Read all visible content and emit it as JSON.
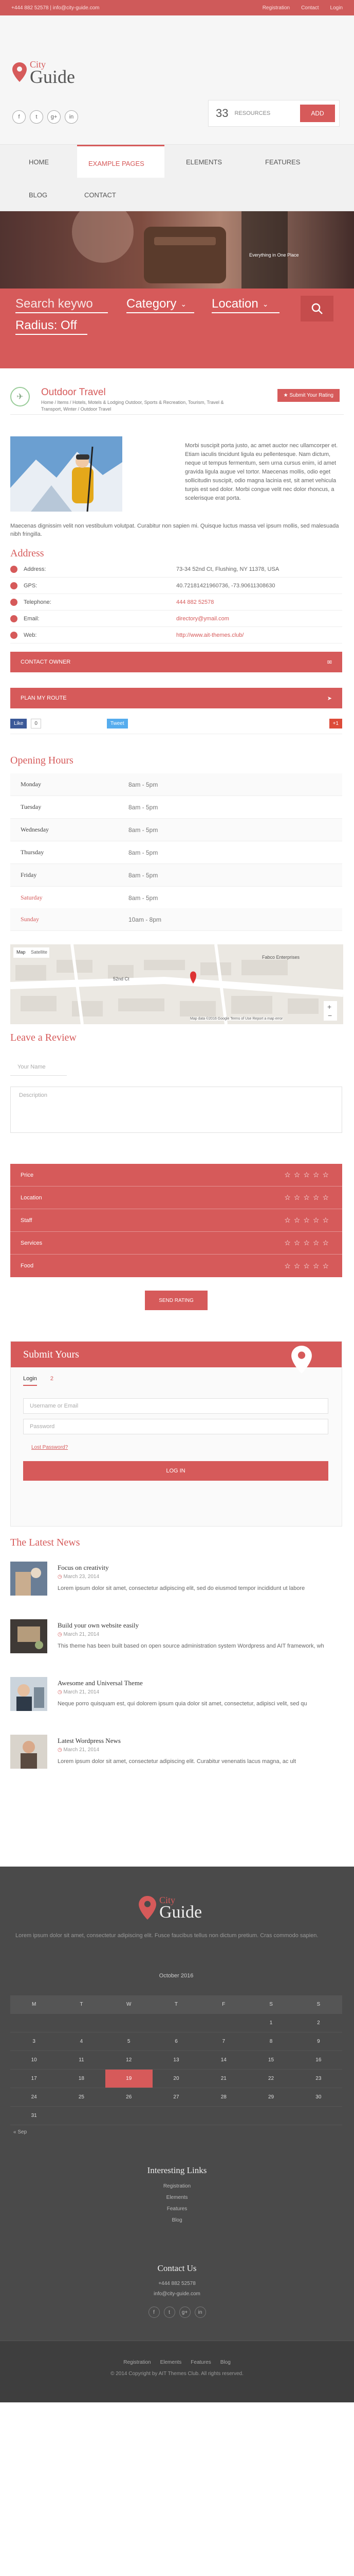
{
  "topbar": {
    "contact": "+444 882 52578 | info@city-guide.com",
    "links": [
      "Registration",
      "Contact",
      "Login"
    ]
  },
  "brand": {
    "line1": "City",
    "line2": "Guide",
    "accent": "#d65a5a"
  },
  "social": [
    "f",
    "t",
    "g+",
    "in"
  ],
  "resources": {
    "count": "33",
    "label": "RESOURCES",
    "add_label": "ADD"
  },
  "nav": {
    "items": [
      "HOME",
      "EXAMPLE PAGES",
      "ELEMENTS",
      "FEATURES",
      "BLOG",
      "CONTACT"
    ],
    "active": "EXAMPLE PAGES"
  },
  "hero": {
    "tag": "Everything in One Place"
  },
  "search": {
    "keyword_placeholder": "Search keywo",
    "category_label": "Category",
    "location_label": "Location",
    "radius_label": "Radius: Off"
  },
  "listing": {
    "title": "Outdoor Travel",
    "breadcrumb": "Home  /  Items  /  Hotels, Motels & Lodging Outdoor, Sports & Recreation, Tourism, Travel & Transport, Winter  /  Outdoor Travel",
    "submit_rating": "Submit Your Rating",
    "description": "Morbi suscipit porta justo, ac amet auctor nec ullamcorper et. Etiam iaculis tincidunt ligula eu pellentesque. Nam dictum, neque ut tempus fermentum, sem urna cursus enim, id amet gravida ligula augue vel tortor. Maecenas mollis, odio eget sollicitudin suscipit, odio magna lacinia est, sit amet vehicula turpis est sed dolor. Morbi congue velit nec dolor rhoncus, a scelerisque erat porta.",
    "description2": "Maecenas dignissim velit non vestibulum volutpat. Curabitur non sapien mi. Quisque luctus massa vel ipsum mollis, sed malesuada nibh fringilla."
  },
  "address": {
    "heading": "Address",
    "rows": [
      {
        "key": "Address:",
        "value": "73-34 52nd Ct, Flushing, NY 11378, USA"
      },
      {
        "key": "GPS:",
        "value": "40.72181421960736, -73.90611308630"
      },
      {
        "key": "Telephone:",
        "value": "444 882 52578"
      },
      {
        "key": "Email:",
        "value": "directory@ymail.com"
      },
      {
        "key": "Web:",
        "value": "http://www.ait-themes.club/"
      }
    ],
    "contact_owner": "CONTACT OWNER",
    "plan_route": "PLAN MY ROUTE",
    "share": [
      "Like",
      "0",
      "Tweet",
      "+1"
    ]
  },
  "hours": {
    "heading": "Opening Hours",
    "rows": [
      {
        "day": "Monday",
        "time": "8am - 5pm"
      },
      {
        "day": "Tuesday",
        "time": "8am - 5pm"
      },
      {
        "day": "Wednesday",
        "time": "8am - 5pm"
      },
      {
        "day": "Thursday",
        "time": "8am - 5pm"
      },
      {
        "day": "Friday",
        "time": "8am - 5pm"
      },
      {
        "day": "Saturday",
        "time": "8am - 5pm"
      },
      {
        "day": "Sunday",
        "time": "10am - 8pm"
      }
    ],
    "map_labels": [
      "Map",
      "Satellite",
      "52nd Ct",
      "Fabco Enterprises"
    ],
    "map_footer": "Map data ©2016 Google   Terms of Use   Report a map error"
  },
  "review": {
    "heading": "Leave a Review",
    "name_placeholder": "Your Name",
    "desc_placeholder": "Description",
    "ratings": [
      "Price",
      "Location",
      "Staff",
      "Services",
      "Food"
    ],
    "stars": "☆☆☆☆☆",
    "send": "SEND RATING"
  },
  "submit_box": {
    "heading": "Submit Yours",
    "tabs": [
      "Login",
      "2"
    ],
    "username_placeholder": "Username or Email",
    "password_placeholder": "Password",
    "lost_password": "Lost Password?",
    "login": "LOG IN"
  },
  "news": {
    "heading": "The Latest News",
    "items": [
      {
        "title": "Focus on creativity",
        "date": "March 23, 2014",
        "text": "Lorem ipsum dolor sit amet, consectetur adipiscing elit, sed do eiusmod tempor incididunt ut labore"
      },
      {
        "title": "Build your own website easily",
        "date": "March 21, 2014",
        "text": "This theme has been built based on open source administration system Wordpress and AIT framework, wh"
      },
      {
        "title": "Awesome and Universal Theme",
        "date": "March 21, 2014",
        "text": "Neque porro quisquam est, qui dolorem ipsum quia dolor sit amet, consectetur, adipisci velit, sed qu"
      },
      {
        "title": "Latest Wordpress News",
        "date": "March 21, 2014",
        "text": "Lorem ipsum dolor sit amet, consectetur adipiscing elit. Curabitur venenatis lacus magna, ac ult"
      }
    ]
  },
  "footer": {
    "brand1": "City",
    "brand2": "Guide",
    "about": "Lorem ipsum dolor sit amet, consectetur adipiscing elit. Fusce faucibus tellus non dictum pretium. Cras commodo sapien.",
    "calendar_title": "October 2016",
    "calendar_days": [
      "M",
      "T",
      "W",
      "T",
      "F",
      "S",
      "S"
    ],
    "calendar_rows": [
      [
        "",
        "",
        "",
        "",
        "",
        "1",
        "2"
      ],
      [
        "3",
        "4",
        "5",
        "6",
        "7",
        "8",
        "9"
      ],
      [
        "10",
        "11",
        "12",
        "13",
        "14",
        "15",
        "16"
      ],
      [
        "17",
        "18",
        "19",
        "20",
        "21",
        "22",
        "23"
      ],
      [
        "24",
        "25",
        "26",
        "27",
        "28",
        "29",
        "30"
      ],
      [
        "31",
        "",
        "",
        "",
        "",
        "",
        ""
      ]
    ],
    "calendar_nav": [
      "« Sep",
      ""
    ],
    "links_heading": "Interesting Links",
    "links": [
      "Registration",
      "Elements",
      "Features",
      "Blog"
    ],
    "contact_heading": "Contact Us",
    "contact": [
      "+444 882 52578",
      "info@city-guide.com"
    ],
    "bottom_links": [
      "Registration",
      "Elements",
      "Features",
      "Blog"
    ],
    "copyright": "© 2014 Copyright by AIT Themes Club. All rights reserved."
  }
}
